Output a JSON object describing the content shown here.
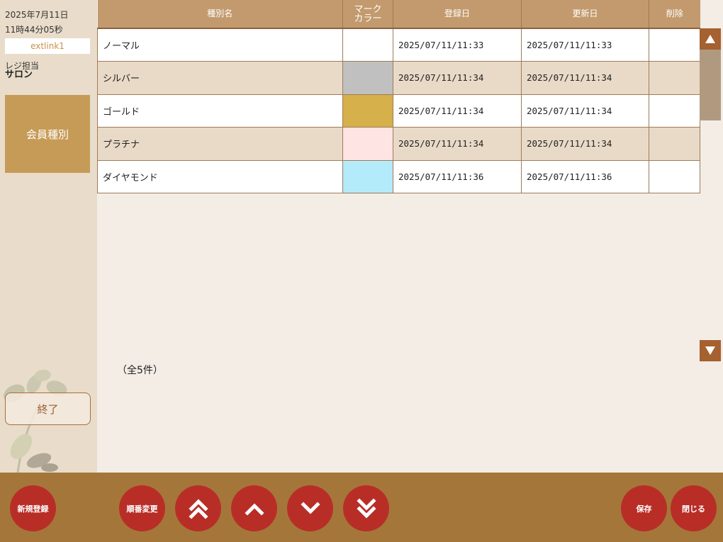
{
  "header": {
    "date": "2025年7月11日",
    "time": "11時44分05秒",
    "terminal": "extlink1"
  },
  "cashier": {
    "label": "レジ担当",
    "name": "サロン"
  },
  "sidebar": {
    "menu_label": "会員種別",
    "end_label": "終了"
  },
  "table": {
    "columns": {
      "name": "種別名",
      "mark_color": "マーク\nカラー",
      "registered": "登録日",
      "updated": "更新日",
      "delete": "削除"
    },
    "rows": [
      {
        "name": "ノーマル",
        "color": "#ffffff",
        "registered": "2025/07/11/11:33",
        "updated": "2025/07/11/11:33"
      },
      {
        "name": "シルバー",
        "color": "#c0c0c0",
        "registered": "2025/07/11/11:34",
        "updated": "2025/07/11/11:34"
      },
      {
        "name": "ゴールド",
        "color": "#d6b04a",
        "registered": "2025/07/11/11:34",
        "updated": "2025/07/11/11:34"
      },
      {
        "name": "プラチナ",
        "color": "#ffe4e4",
        "registered": "2025/07/11/11:34",
        "updated": "2025/07/11/11:34"
      },
      {
        "name": "ダイヤモンド",
        "color": "#b3ebfb",
        "registered": "2025/07/11/11:36",
        "updated": "2025/07/11/11:36"
      }
    ]
  },
  "count_text": "（全5件）",
  "footer": {
    "new_label": "新規登録",
    "reorder_label": "順番変更",
    "save_label": "保存",
    "close_label": "閉じる"
  },
  "colors": {
    "header_bg": "#c29a6d",
    "sidebar_bg": "#e9dcca",
    "accent_button": "#b82e27",
    "bottom_bar": "#a57639",
    "scroll_arrow": "#a5612f"
  }
}
